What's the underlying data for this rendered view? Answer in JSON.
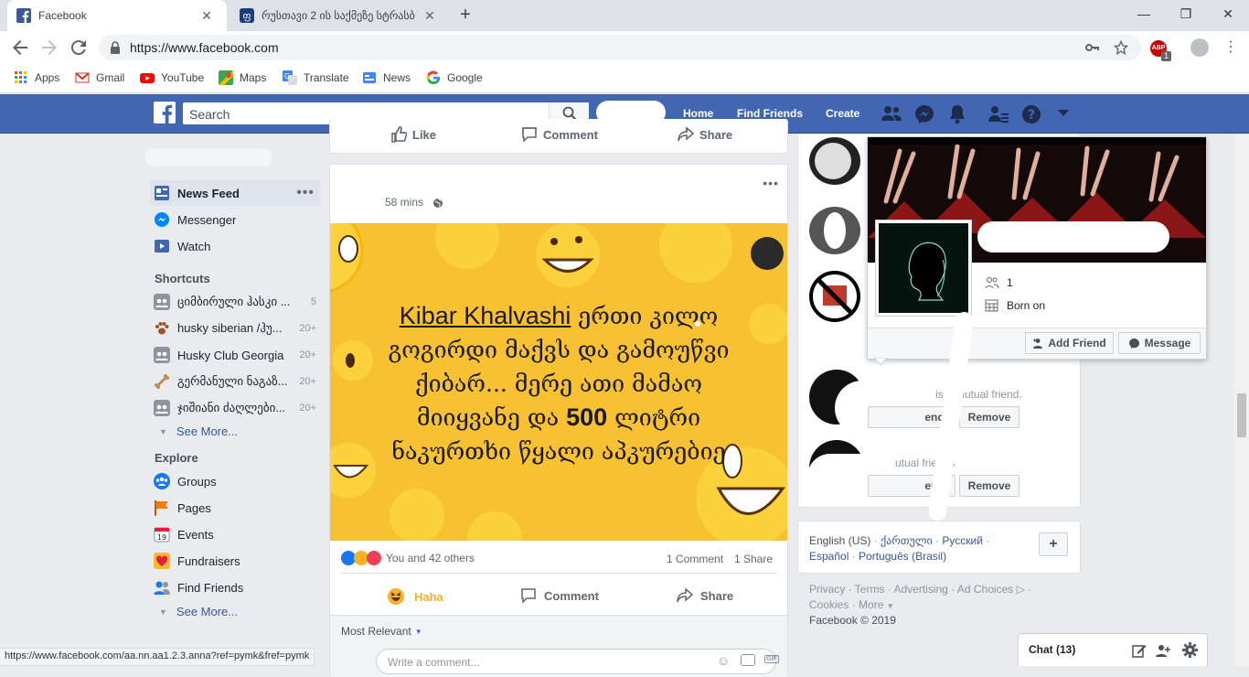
{
  "browser": {
    "tabs": [
      {
        "title": "Facebook",
        "icon": "facebook-icon"
      },
      {
        "title": "რუსთავი 2 ის საქმეზე სტრასბ",
        "icon": "tab-favicon-icon"
      }
    ],
    "url": "https://www.facebook.com",
    "bookmarks": [
      {
        "label": "Apps",
        "icon": "apps-grid-icon"
      },
      {
        "label": "Gmail",
        "icon": "gmail-icon"
      },
      {
        "label": "YouTube",
        "icon": "youtube-icon"
      },
      {
        "label": "Maps",
        "icon": "maps-icon"
      },
      {
        "label": "Translate",
        "icon": "translate-icon"
      },
      {
        "label": "News",
        "icon": "news-icon"
      },
      {
        "label": "Google",
        "icon": "google-icon"
      }
    ],
    "extension_badge": "1",
    "extension_label": "ABP",
    "status_url": "https://www.facebook.com/aa.nn.aa1.2.3.anna?ref=pymk&fref=pymk"
  },
  "fb_header": {
    "search_placeholder": "Search",
    "nav": {
      "home": "Home",
      "find_friends": "Find Friends",
      "create": "Create"
    },
    "colors": {
      "bar": "#4267b2",
      "link": "#365899"
    }
  },
  "sidebar": {
    "main": [
      {
        "label": "News Feed",
        "icon": "news-feed-icon"
      },
      {
        "label": "Messenger",
        "icon": "messenger-icon"
      },
      {
        "label": "Watch",
        "icon": "watch-icon"
      }
    ],
    "shortcuts_title": "Shortcuts",
    "shortcuts": [
      {
        "label": "ციმბირული ჰასკი ...",
        "count": "5",
        "icon": "group-icon"
      },
      {
        "label": "husky siberian /ჰუ...",
        "count": "20+",
        "icon": "paw-icon"
      },
      {
        "label": "Husky Club Georgia",
        "count": "20+",
        "icon": "group-icon"
      },
      {
        "label": "გერმანული ნაგაზ...",
        "count": "20+",
        "icon": "bone-icon"
      },
      {
        "label": "ჯიშიანი ძაღლები...",
        "count": "20+",
        "icon": "group-icon"
      }
    ],
    "see_more_1": "See More...",
    "explore_title": "Explore",
    "explore": [
      {
        "label": "Groups",
        "icon": "groups-icon"
      },
      {
        "label": "Pages",
        "icon": "pages-flag-icon"
      },
      {
        "label": "Events",
        "icon": "events-calendar-icon"
      },
      {
        "label": "Fundraisers",
        "icon": "fundraisers-heart-icon"
      },
      {
        "label": "Find Friends",
        "icon": "find-friends-icon"
      }
    ],
    "see_more_2": "See More..."
  },
  "prev_post": {
    "like": "Like",
    "comment": "Comment",
    "share": "Share"
  },
  "post": {
    "time": "58 mins",
    "image_text": {
      "name": "Kibar Khalvashi",
      "line1": " ერთი კილო",
      "line2": "გოგირდი მაქვს და გამოუწვი",
      "line3": "ქიბარ... მერე ათი მამაო",
      "line4a": "მიიყვანე და ",
      "line4b": "500",
      "line4c": " ლიტრი",
      "line5": "ნაკურთხი წყალი აპკურებიე"
    },
    "reactions_text": "You and 42 others",
    "comments_count": "1 Comment",
    "shares_count": "1 Share",
    "haha": "Haha",
    "comment": "Comment",
    "share": "Share",
    "most_relevant": "Most Relevant",
    "write_comment": "Write a comment..."
  },
  "hovercard": {
    "friends_line": "1",
    "born_line": "Born on",
    "add_friend": "Add Friend",
    "message": "Message"
  },
  "pymk": {
    "mutual_1": "is a mutual friend.",
    "add_friend_partial": "end",
    "remove_1": "Remove",
    "mutual_2": "utual friends",
    "add_friend_partial_2": "end",
    "remove_2": "Remove"
  },
  "languages": {
    "items": [
      "English (US)",
      "ქართული",
      "Русский",
      "Español",
      "Português (Brasil)"
    ],
    "add": "+"
  },
  "footer": {
    "line1": [
      "Privacy",
      "Terms",
      "Advertising",
      "Ad Choices"
    ],
    "line2": [
      "Cookies",
      "More"
    ],
    "copyright": "Facebook © 2019"
  },
  "chat": {
    "label": "Chat (13)"
  }
}
